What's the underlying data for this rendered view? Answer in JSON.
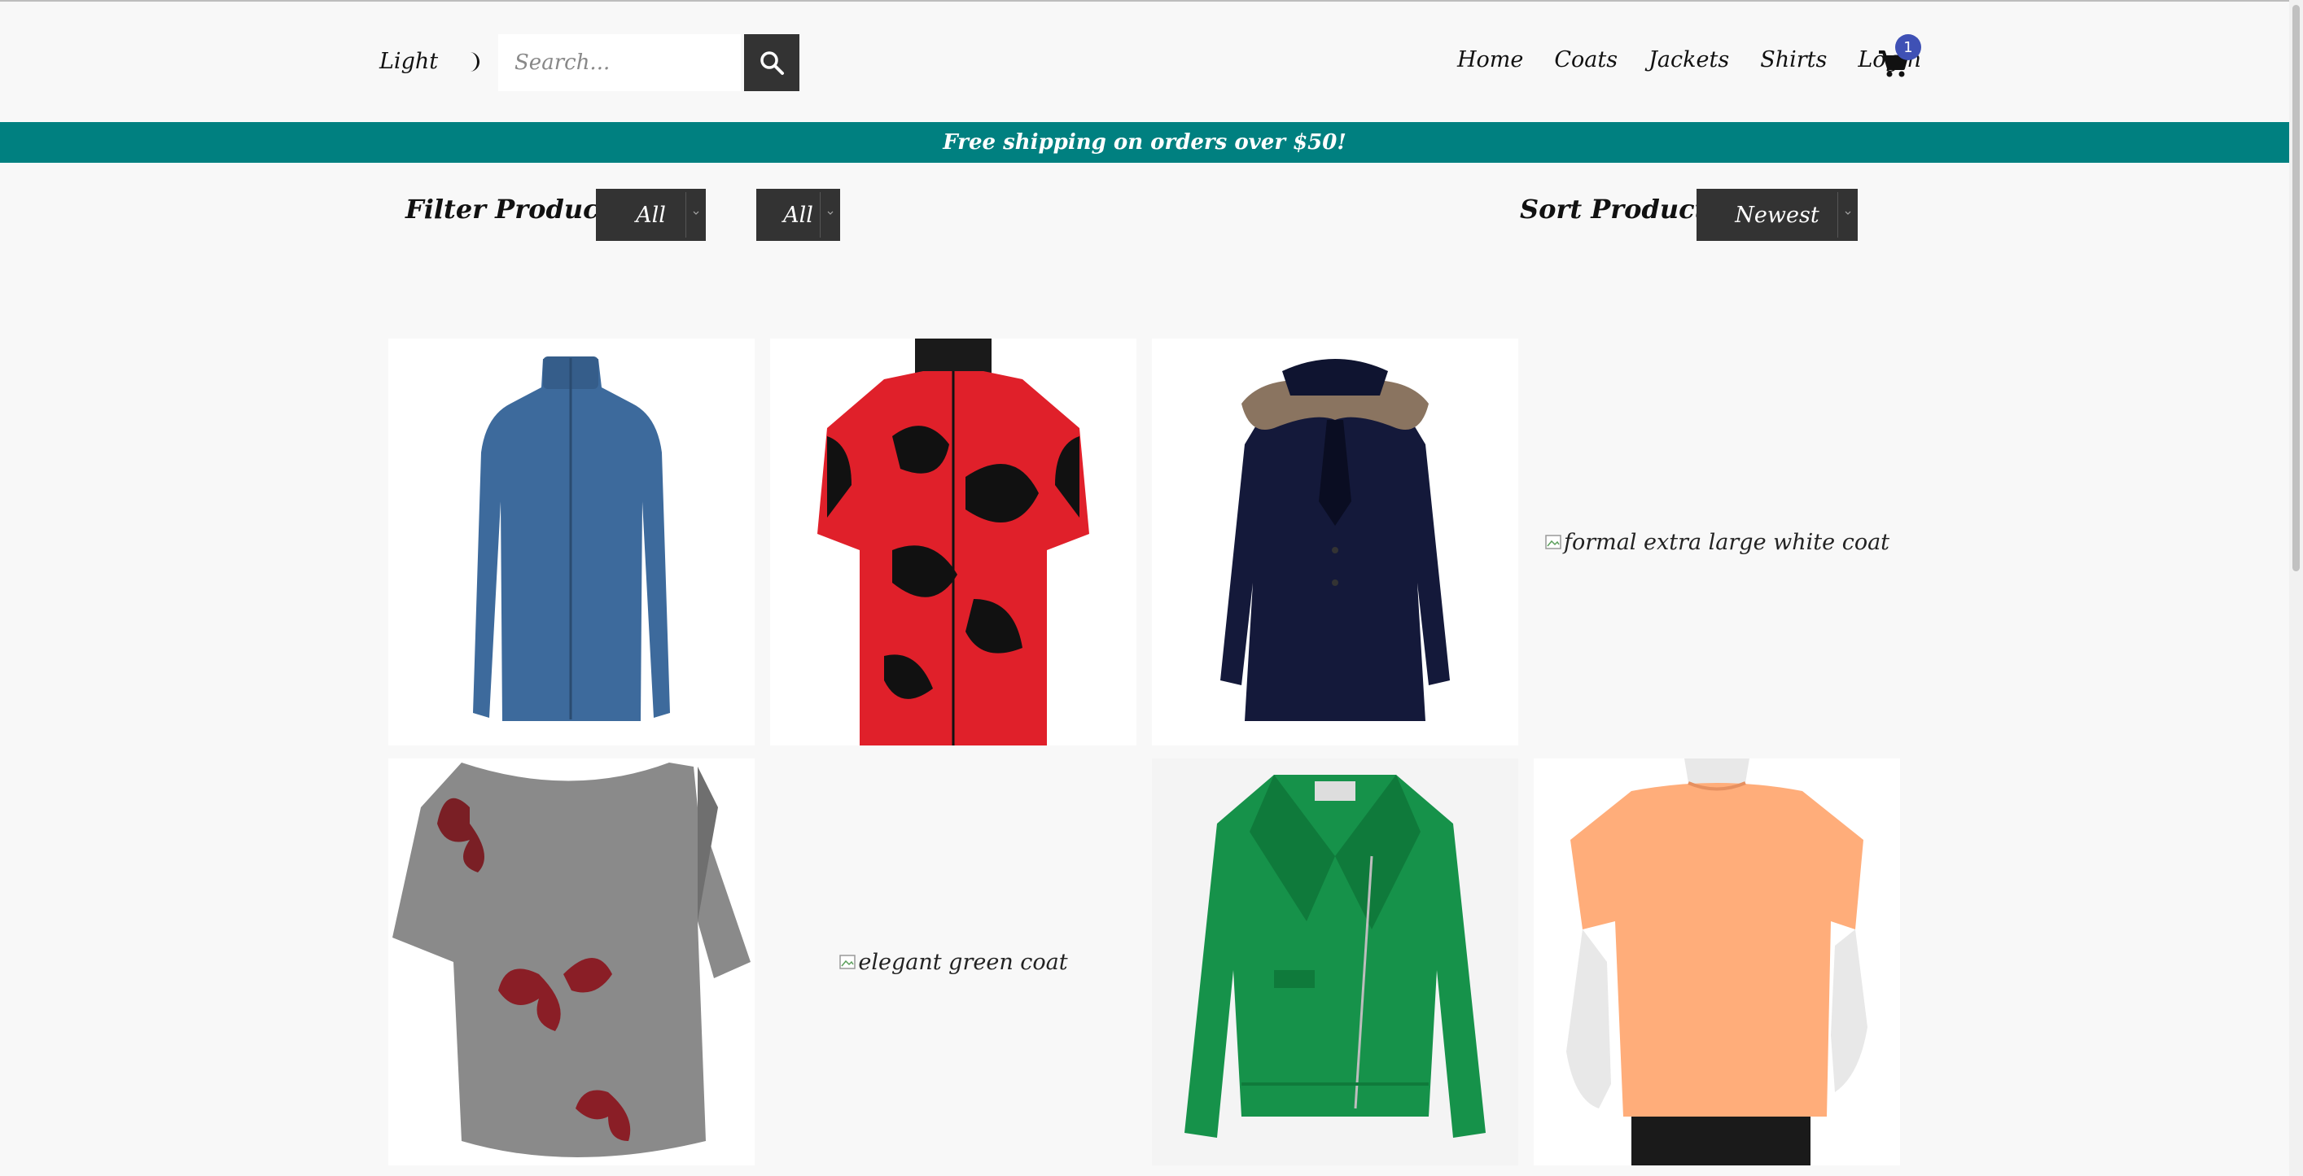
{
  "header": {
    "theme_label": "Light",
    "search": {
      "placeholder": "Search..."
    },
    "nav": [
      "Home",
      "Coats",
      "Jackets",
      "Shirts",
      "Login"
    ],
    "cart_count": "1"
  },
  "banner": {
    "text": "Free shipping on orders over $50!"
  },
  "filters": {
    "label": "Filter Products",
    "size_value": "All",
    "category_value": "All",
    "sort_label": "Sort Products",
    "sort_value": "Newest"
  },
  "products": [
    {
      "alt": "",
      "image": "blue-zip-jacket"
    },
    {
      "alt": "",
      "image": "red-black-floral-cycling-shirt"
    },
    {
      "alt": "",
      "image": "navy-coat-fur-collar"
    },
    {
      "alt": "formal extra large white coat",
      "image": "broken-image"
    },
    {
      "alt": "",
      "image": "grey-butterfly-shirt"
    },
    {
      "alt": "elegant green coat",
      "image": "broken-image"
    },
    {
      "alt": "",
      "image": "green-suede-jacket"
    },
    {
      "alt": "",
      "image": "orange-tee-on-mannequin"
    }
  ],
  "colors": {
    "banner": "#008080",
    "dark_control": "#333333",
    "badge": "#3f51b5",
    "page_bg": "#f8f8f8"
  }
}
